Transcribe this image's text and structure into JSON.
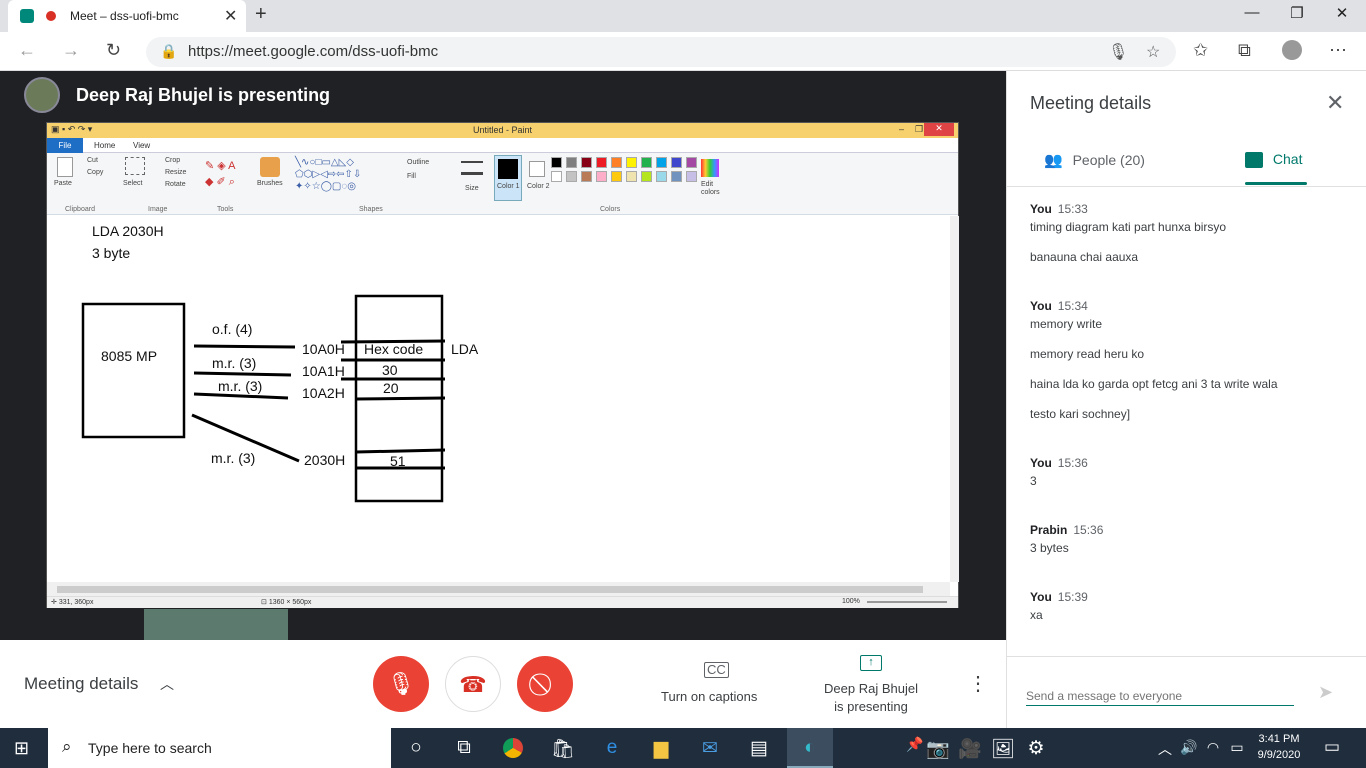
{
  "browser": {
    "tab_title": "Meet – dss-uofi-bmc",
    "tab_close": "✕",
    "new_tab": "+",
    "url": "https://meet.google.com/dss-uofi-bmc",
    "win_minimize": "—",
    "win_restore": "❐",
    "win_close": "✕"
  },
  "stage": {
    "presenting_title": "Deep Raj Bhujel is presenting"
  },
  "paint": {
    "window_title": "Untitled - Paint",
    "tabs": [
      "File",
      "Home",
      "View"
    ],
    "ribbon": {
      "clipboard": {
        "paste": "Paste",
        "cut": "Cut",
        "copy": "Copy",
        "label": "Clipboard"
      },
      "image": {
        "select": "Select",
        "crop": "Crop",
        "resize": "Resize",
        "rotate": "Rotate",
        "label": "Image"
      },
      "tools_label": "Tools",
      "brushes": "Brushes",
      "shapes": {
        "outline": "Outline",
        "fill": "Fill",
        "label": "Shapes"
      },
      "size": "Size",
      "color1": "Color 1",
      "color2": "Color 2",
      "colors_label": "Colors",
      "edit_colors": "Edit colors",
      "palette": [
        "#000000",
        "#7f7f7f",
        "#880015",
        "#ed1c24",
        "#ff7f27",
        "#fff200",
        "#22b14c",
        "#00a2e8",
        "#3f48cc",
        "#a349a4",
        "#ffffff",
        "#c3c3c3",
        "#b97a57",
        "#ffaec9",
        "#ffc90e",
        "#efe4b0",
        "#b5e61d",
        "#99d9ea",
        "#7092be",
        "#c8bfe7"
      ]
    },
    "status": {
      "cursor_pos": "331, 360px",
      "canvas_size": "1360 × 560px",
      "zoom": "100%"
    },
    "drawing": {
      "line1": "LDA 2030H",
      "line2": "3 byte",
      "mp_label": "8085 MP",
      "of4": "o.f. (4)",
      "mr1": "m.r. (3)",
      "mr2": "m.r. (3)",
      "mr3": "m.r. (3)",
      "addr1": "10A0H",
      "addr2": "10A1H",
      "addr3": "10A2H",
      "addr4": "2030H",
      "cell1": "Hex code",
      "cell2": "30",
      "cell3": "20",
      "cell4": "51",
      "lda": "LDA"
    }
  },
  "panel": {
    "title": "Meeting details",
    "tab_people": "People (20)",
    "tab_chat": "Chat",
    "messages": [
      {
        "sender": "You",
        "time": "15:33",
        "lines": [
          "timing diagram  kati part hunxa birsyo",
          "banauna chai aauxa"
        ]
      },
      {
        "sender": "You",
        "time": "15:34",
        "lines": [
          "memory write",
          "memory read heru ko",
          "haina lda  ko garda opt fetcg ani 3 ta write wala",
          "testo kari sochney]"
        ]
      },
      {
        "sender": "You",
        "time": "15:36",
        "lines": [
          "3"
        ]
      },
      {
        "sender": "Prabin",
        "time": "15:36",
        "lines": [
          "3 bytes"
        ]
      },
      {
        "sender": "You",
        "time": "15:39",
        "lines": [
          "xa"
        ]
      }
    ],
    "input_placeholder": "Send a message to everyone"
  },
  "bottombar": {
    "meeting_details": "Meeting details",
    "captions": "Turn on captions",
    "presenting_line1": "Deep Raj Bhujel",
    "presenting_line2": "is presenting"
  },
  "taskbar": {
    "search_placeholder": "Type here to search",
    "time": "3:41 PM",
    "date": "9/9/2020"
  }
}
